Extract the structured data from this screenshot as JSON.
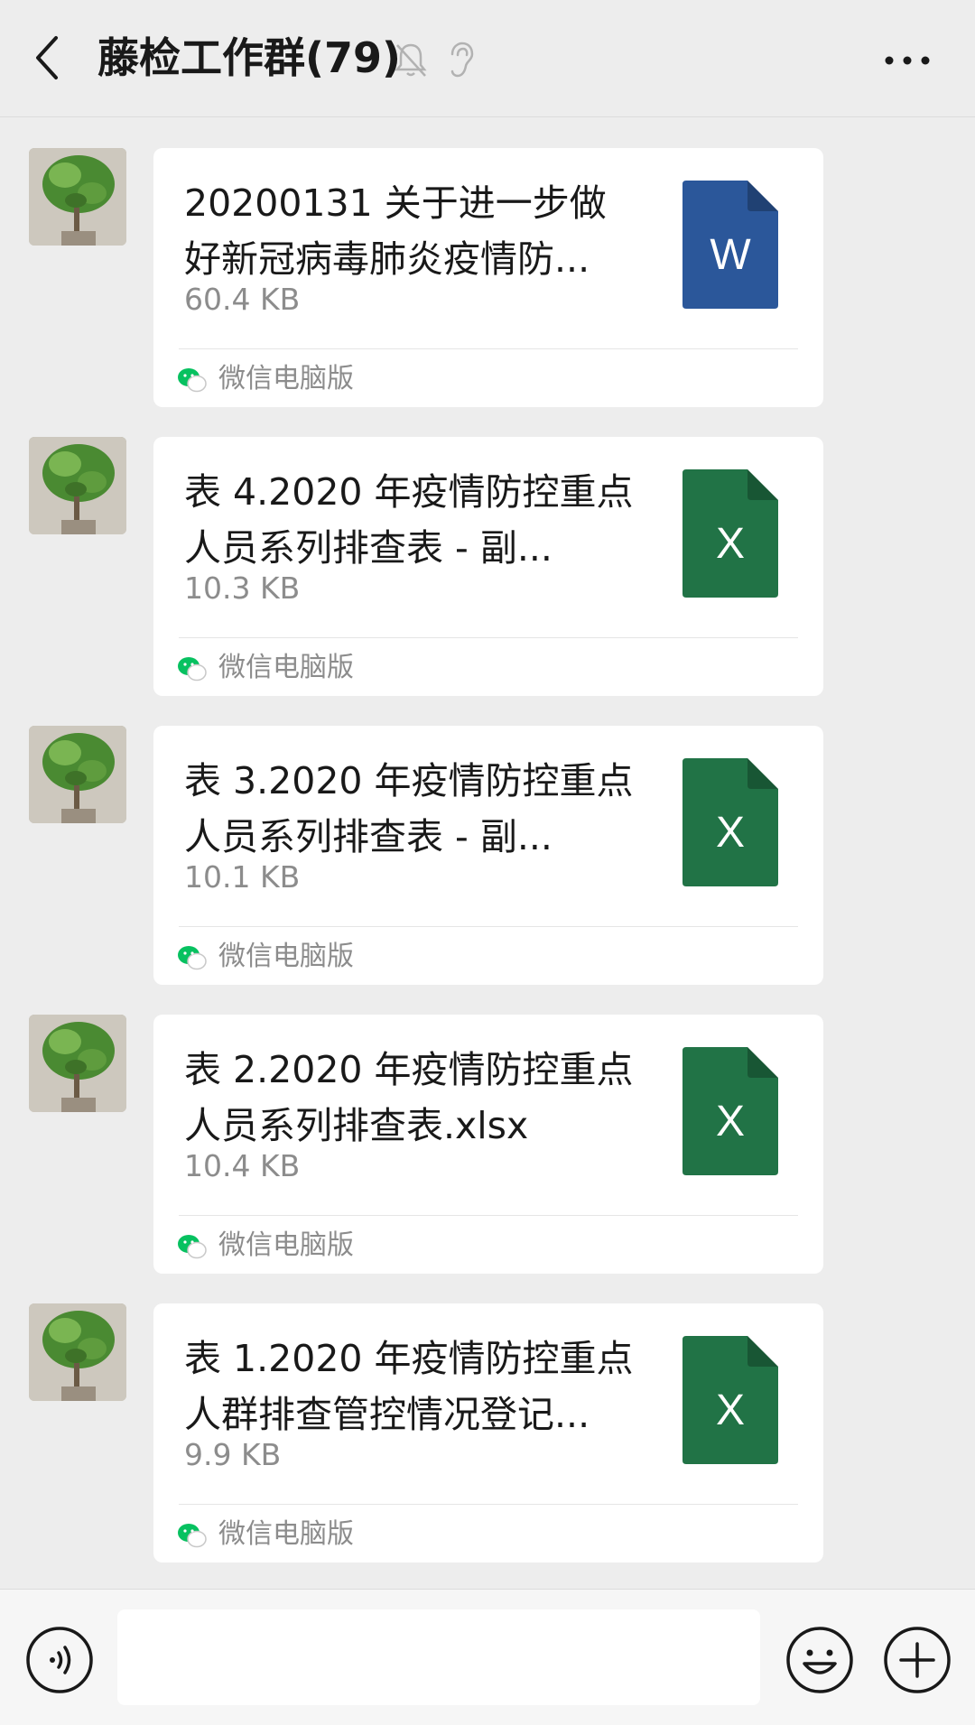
{
  "header": {
    "title": "藤检工作群(79)",
    "icons": [
      "back-icon",
      "mute-icon",
      "ear-icon",
      "more-icon"
    ]
  },
  "messages": [
    {
      "file_name": "20200131 关于进一步做好新冠病毒肺炎疫情防...",
      "file_size": "60.4 KB",
      "file_type": "word",
      "file_letter": "W",
      "icon_color": "#2b579a",
      "source": "微信电脑版"
    },
    {
      "file_name": "表 4.2020 年疫情防控重点人员系列排查表 - 副...",
      "file_size": "10.3 KB",
      "file_type": "excel",
      "file_letter": "X",
      "icon_color": "#217346",
      "source": "微信电脑版"
    },
    {
      "file_name": "表 3.2020 年疫情防控重点人员系列排查表 - 副...",
      "file_size": "10.1 KB",
      "file_type": "excel",
      "file_letter": "X",
      "icon_color": "#217346",
      "source": "微信电脑版"
    },
    {
      "file_name": "表 2.2020 年疫情防控重点人员系列排查表.xlsx",
      "file_size": "10.4 KB",
      "file_type": "excel",
      "file_letter": "X",
      "icon_color": "#217346",
      "source": "微信电脑版"
    },
    {
      "file_name": "表 1.2020 年疫情防控重点人群排查管控情况登记...",
      "file_size": "9.9 KB",
      "file_type": "excel",
      "file_letter": "X",
      "icon_color": "#217346",
      "source": "微信电脑版"
    }
  ],
  "input_bar": {
    "input_value": "",
    "icons": [
      "voice-icon",
      "emoji-icon",
      "plus-icon"
    ]
  },
  "colors": {
    "background": "#ededed",
    "card": "#ffffff",
    "secondary_text": "#8c8c8c",
    "wechat_green": "#07c160"
  }
}
